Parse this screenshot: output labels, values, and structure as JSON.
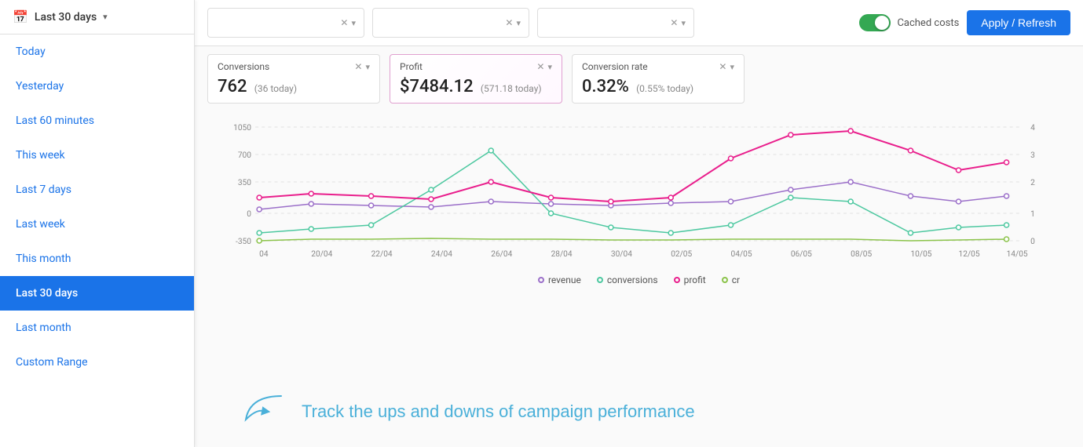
{
  "sidebar": {
    "header": {
      "label": "Last 30 days",
      "icon": "📅"
    },
    "items": [
      {
        "label": "Today",
        "active": false
      },
      {
        "label": "Yesterday",
        "active": false
      },
      {
        "label": "Last 60 minutes",
        "active": false
      },
      {
        "label": "This week",
        "active": false
      },
      {
        "label": "Last 7 days",
        "active": false
      },
      {
        "label": "Last week",
        "active": false
      },
      {
        "label": "This month",
        "active": false
      },
      {
        "label": "Last 30 days",
        "active": true
      },
      {
        "label": "Last month",
        "active": false
      },
      {
        "label": "Custom Range",
        "active": false
      }
    ]
  },
  "topbar": {
    "filter1_placeholder": "",
    "filter2_placeholder": "",
    "filter3_placeholder": "",
    "cached_costs_label": "Cached costs",
    "apply_button_label": "Apply / Refresh"
  },
  "metrics": [
    {
      "label": "Conversions",
      "value": "762",
      "sub": "(36 today)",
      "type": "conversions"
    },
    {
      "label": "Profit",
      "value": "$7484.12",
      "sub": "(571.18 today)",
      "type": "profit"
    },
    {
      "label": "Conversion rate",
      "value": "0.32%",
      "sub": "(0.55% today)",
      "type": "cr"
    }
  ],
  "chart": {
    "x_labels": [
      "04",
      "20/04",
      "22/04",
      "24/04",
      "26/04",
      "28/04",
      "30/04",
      "02/05",
      "04/05",
      "06/05",
      "08/05",
      "10/05",
      "12/05",
      "14/05"
    ],
    "y_left_labels": [
      "1050",
      "700",
      "350",
      "0",
      "-350"
    ],
    "y_right_labels": [
      "4",
      "3",
      "2",
      "1",
      "0"
    ],
    "legend": [
      {
        "key": "revenue",
        "label": "revenue",
        "color": "#9b6fc9"
      },
      {
        "key": "conversions",
        "label": "conversions",
        "color": "#4dc8a0"
      },
      {
        "key": "profit",
        "label": "profit",
        "color": "#e91e8c"
      },
      {
        "key": "cr",
        "label": "cr",
        "color": "#8bc34a"
      }
    ]
  },
  "annotation": {
    "text": "Track the ups and downs of campaign performance",
    "arrow_char": "↗"
  }
}
